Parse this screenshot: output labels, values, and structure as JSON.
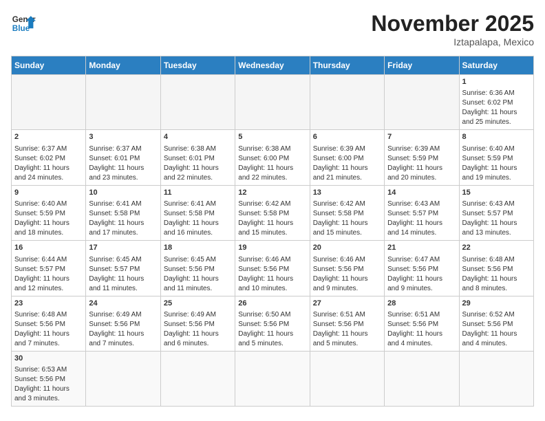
{
  "header": {
    "logo_general": "General",
    "logo_blue": "Blue",
    "month_title": "November 2025",
    "subtitle": "Iztapalapa, Mexico"
  },
  "days_of_week": [
    "Sunday",
    "Monday",
    "Tuesday",
    "Wednesday",
    "Thursday",
    "Friday",
    "Saturday"
  ],
  "weeks": [
    [
      {
        "day": "",
        "text": ""
      },
      {
        "day": "",
        "text": ""
      },
      {
        "day": "",
        "text": ""
      },
      {
        "day": "",
        "text": ""
      },
      {
        "day": "",
        "text": ""
      },
      {
        "day": "",
        "text": ""
      },
      {
        "day": "1",
        "text": "Sunrise: 6:36 AM\nSunset: 6:02 PM\nDaylight: 11 hours\nand 25 minutes."
      }
    ],
    [
      {
        "day": "2",
        "text": "Sunrise: 6:37 AM\nSunset: 6:02 PM\nDaylight: 11 hours\nand 24 minutes."
      },
      {
        "day": "3",
        "text": "Sunrise: 6:37 AM\nSunset: 6:01 PM\nDaylight: 11 hours\nand 23 minutes."
      },
      {
        "day": "4",
        "text": "Sunrise: 6:38 AM\nSunset: 6:01 PM\nDaylight: 11 hours\nand 22 minutes."
      },
      {
        "day": "5",
        "text": "Sunrise: 6:38 AM\nSunset: 6:00 PM\nDaylight: 11 hours\nand 22 minutes."
      },
      {
        "day": "6",
        "text": "Sunrise: 6:39 AM\nSunset: 6:00 PM\nDaylight: 11 hours\nand 21 minutes."
      },
      {
        "day": "7",
        "text": "Sunrise: 6:39 AM\nSunset: 5:59 PM\nDaylight: 11 hours\nand 20 minutes."
      },
      {
        "day": "8",
        "text": "Sunrise: 6:40 AM\nSunset: 5:59 PM\nDaylight: 11 hours\nand 19 minutes."
      }
    ],
    [
      {
        "day": "9",
        "text": "Sunrise: 6:40 AM\nSunset: 5:59 PM\nDaylight: 11 hours\nand 18 minutes."
      },
      {
        "day": "10",
        "text": "Sunrise: 6:41 AM\nSunset: 5:58 PM\nDaylight: 11 hours\nand 17 minutes."
      },
      {
        "day": "11",
        "text": "Sunrise: 6:41 AM\nSunset: 5:58 PM\nDaylight: 11 hours\nand 16 minutes."
      },
      {
        "day": "12",
        "text": "Sunrise: 6:42 AM\nSunset: 5:58 PM\nDaylight: 11 hours\nand 15 minutes."
      },
      {
        "day": "13",
        "text": "Sunrise: 6:42 AM\nSunset: 5:58 PM\nDaylight: 11 hours\nand 15 minutes."
      },
      {
        "day": "14",
        "text": "Sunrise: 6:43 AM\nSunset: 5:57 PM\nDaylight: 11 hours\nand 14 minutes."
      },
      {
        "day": "15",
        "text": "Sunrise: 6:43 AM\nSunset: 5:57 PM\nDaylight: 11 hours\nand 13 minutes."
      }
    ],
    [
      {
        "day": "16",
        "text": "Sunrise: 6:44 AM\nSunset: 5:57 PM\nDaylight: 11 hours\nand 12 minutes."
      },
      {
        "day": "17",
        "text": "Sunrise: 6:45 AM\nSunset: 5:57 PM\nDaylight: 11 hours\nand 11 minutes."
      },
      {
        "day": "18",
        "text": "Sunrise: 6:45 AM\nSunset: 5:56 PM\nDaylight: 11 hours\nand 11 minutes."
      },
      {
        "day": "19",
        "text": "Sunrise: 6:46 AM\nSunset: 5:56 PM\nDaylight: 11 hours\nand 10 minutes."
      },
      {
        "day": "20",
        "text": "Sunrise: 6:46 AM\nSunset: 5:56 PM\nDaylight: 11 hours\nand 9 minutes."
      },
      {
        "day": "21",
        "text": "Sunrise: 6:47 AM\nSunset: 5:56 PM\nDaylight: 11 hours\nand 9 minutes."
      },
      {
        "day": "22",
        "text": "Sunrise: 6:48 AM\nSunset: 5:56 PM\nDaylight: 11 hours\nand 8 minutes."
      }
    ],
    [
      {
        "day": "23",
        "text": "Sunrise: 6:48 AM\nSunset: 5:56 PM\nDaylight: 11 hours\nand 7 minutes."
      },
      {
        "day": "24",
        "text": "Sunrise: 6:49 AM\nSunset: 5:56 PM\nDaylight: 11 hours\nand 7 minutes."
      },
      {
        "day": "25",
        "text": "Sunrise: 6:49 AM\nSunset: 5:56 PM\nDaylight: 11 hours\nand 6 minutes."
      },
      {
        "day": "26",
        "text": "Sunrise: 6:50 AM\nSunset: 5:56 PM\nDaylight: 11 hours\nand 5 minutes."
      },
      {
        "day": "27",
        "text": "Sunrise: 6:51 AM\nSunset: 5:56 PM\nDaylight: 11 hours\nand 5 minutes."
      },
      {
        "day": "28",
        "text": "Sunrise: 6:51 AM\nSunset: 5:56 PM\nDaylight: 11 hours\nand 4 minutes."
      },
      {
        "day": "29",
        "text": "Sunrise: 6:52 AM\nSunset: 5:56 PM\nDaylight: 11 hours\nand 4 minutes."
      }
    ],
    [
      {
        "day": "30",
        "text": "Sunrise: 6:53 AM\nSunset: 5:56 PM\nDaylight: 11 hours\nand 3 minutes."
      },
      {
        "day": "",
        "text": ""
      },
      {
        "day": "",
        "text": ""
      },
      {
        "day": "",
        "text": ""
      },
      {
        "day": "",
        "text": ""
      },
      {
        "day": "",
        "text": ""
      },
      {
        "day": "",
        "text": ""
      }
    ]
  ]
}
